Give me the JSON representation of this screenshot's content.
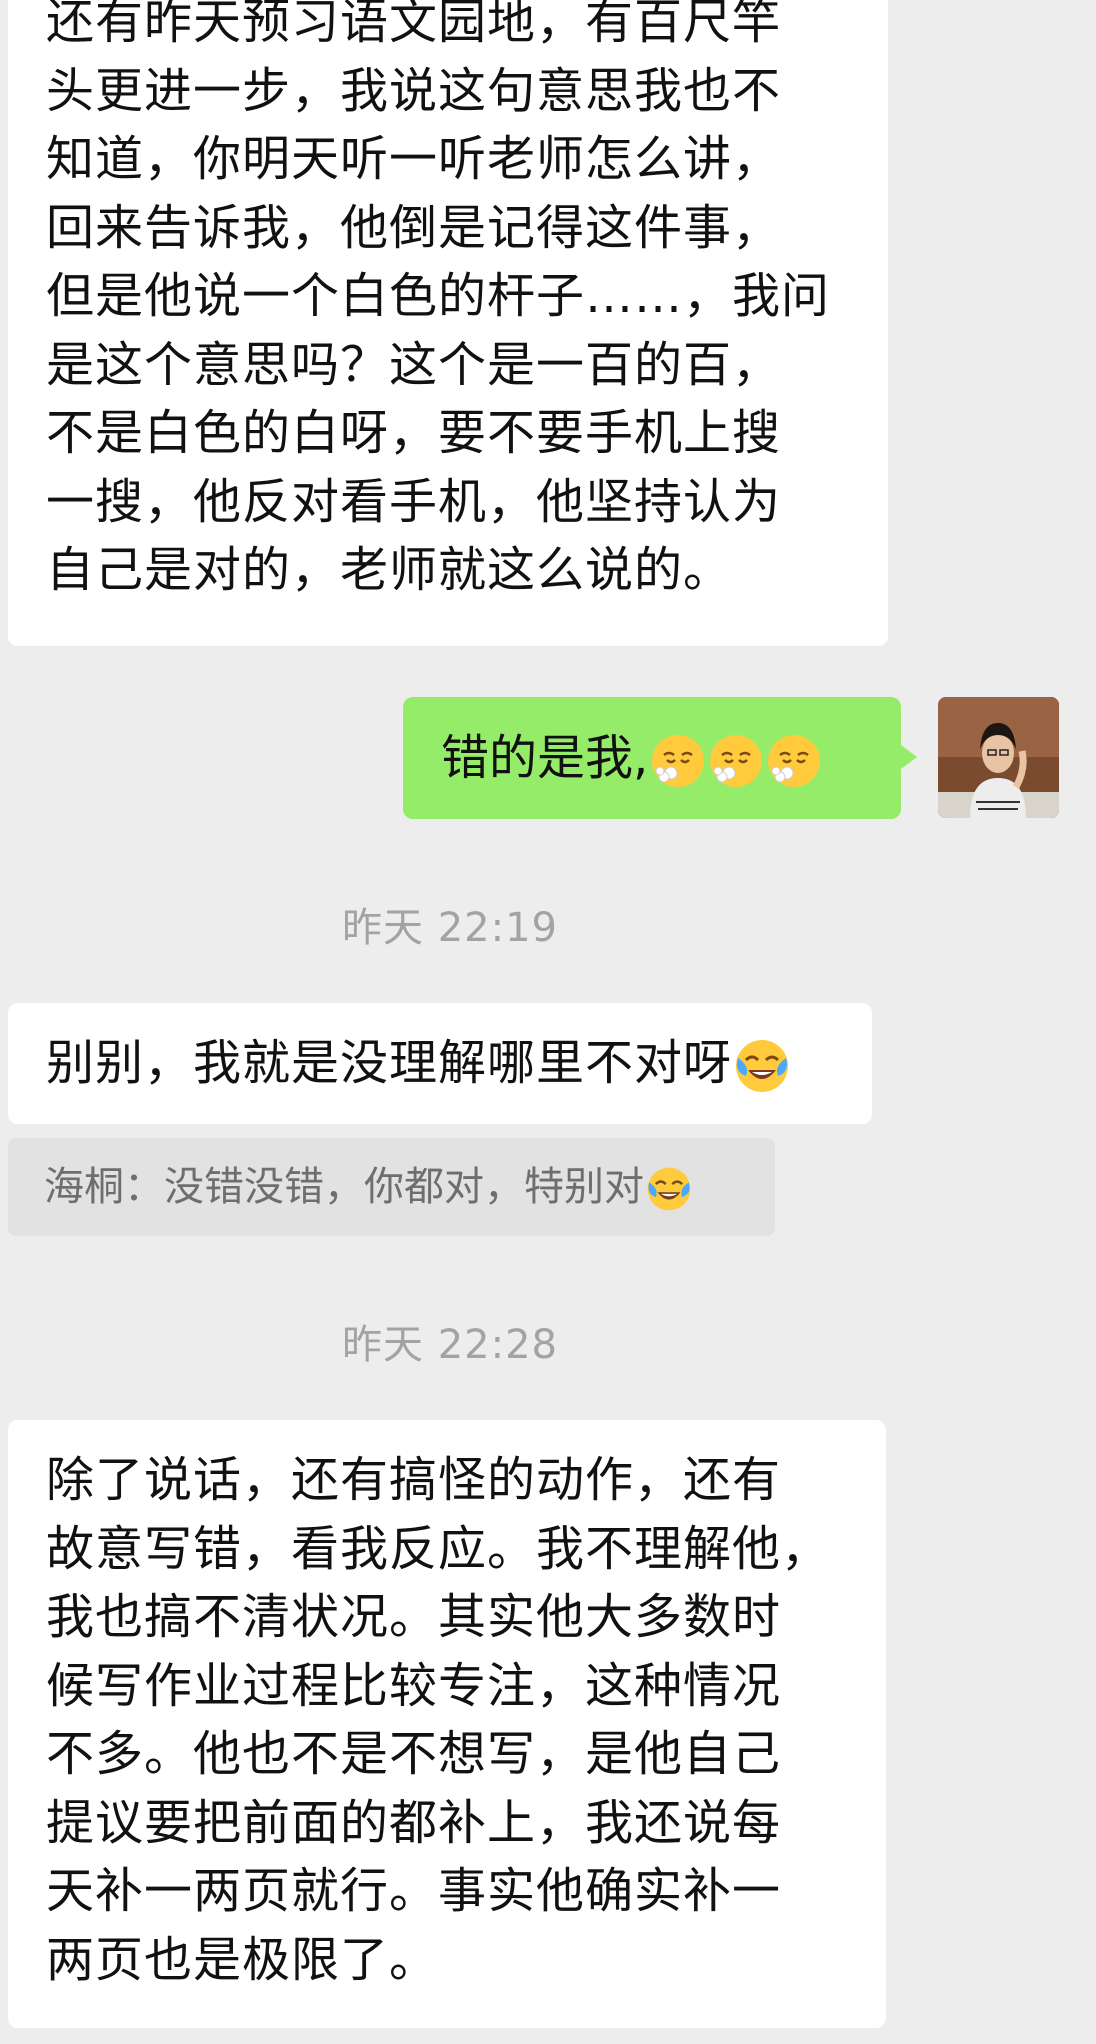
{
  "messages": {
    "first": {
      "lines": [
        "还有昨天预习语文园地，有百尺竿",
        "头更进一步，我说这句意思我也不",
        "知道，你明天听一听老师怎么讲，",
        "回来告诉我，他倒是记得这件事，",
        "但是他说一个白色的杆子……，我问",
        "是这个意思吗？这个是一百的百，",
        "不是白色的白呀，要不要手机上搜",
        "一搜，他反对看手机，他坚持认为",
        "自己是对的，老师就这么说的。"
      ]
    },
    "outgoing": {
      "text": "错的是我,",
      "emojis": [
        "sigh-emoji",
        "sigh-emoji",
        "sigh-emoji"
      ]
    },
    "timestamp1": "昨天 22:19",
    "reply": {
      "text": "别别，我就是没理解哪里不对呀",
      "emoji": "laugh-cry-emoji"
    },
    "quote": {
      "text": "海桐：没错没错，你都对，特别对",
      "emoji": "laugh-cry-emoji"
    },
    "timestamp2": "昨天 22:28",
    "last": {
      "lines": [
        "除了说话，还有搞怪的动作，还有",
        "故意写错，看我反应。我不理解他，",
        "我也搞不清状况。其实他大多数时",
        "候写作业过程比较专注，这种情况",
        "不多。他也不是不想写，是他自己",
        "提议要把前面的都补上，我还说每",
        "天补一两页就行。事实他确实补一",
        "两页也是极限了。"
      ]
    }
  },
  "colors": {
    "background": "#ededed",
    "incoming_bubble": "#ffffff",
    "outgoing_bubble": "#95ec69",
    "timestamp": "#a3a3a3",
    "quote_bg": "#e2e2e2"
  }
}
